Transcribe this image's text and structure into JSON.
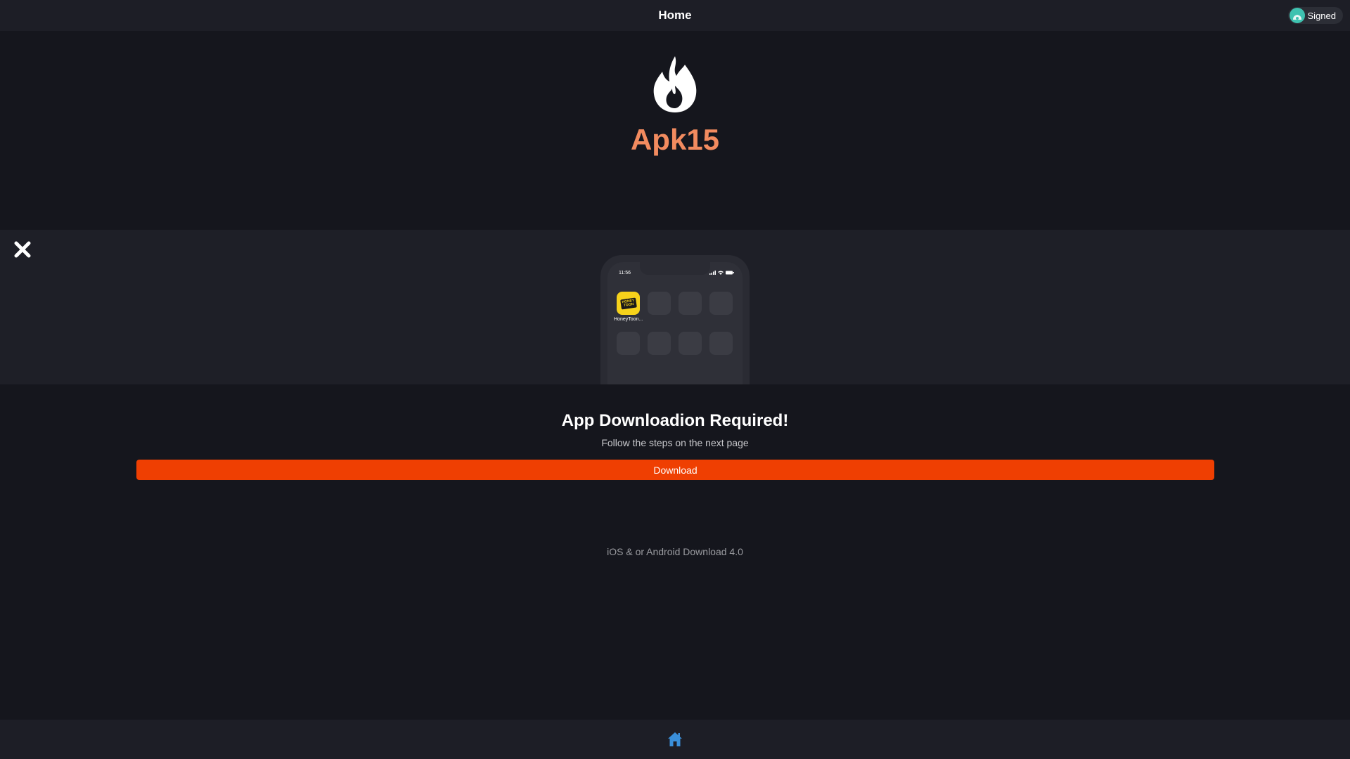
{
  "header": {
    "title": "Home",
    "signed_label": "Signed",
    "avatar_icon": "cloud-avatar-icon"
  },
  "hero": {
    "logo_icon": "flame-icon",
    "brand": "Apk15",
    "brand_color": "#f28b5f"
  },
  "preview": {
    "close_icon": "close-icon",
    "phone": {
      "status_time": "11:56",
      "app": {
        "label": "HoneyToon...",
        "logo_text_top": "HONEY",
        "logo_text_bottom": "TOON"
      },
      "empty_slots": 7
    }
  },
  "main": {
    "heading": "App Downloadion Required!",
    "subtitle": "Follow the steps on the next page",
    "download_label": "Download",
    "download_color": "#ef3f02",
    "version_text": "iOS & or Android Download 4.0"
  },
  "footer": {
    "home_icon": "home-icon",
    "home_color": "#3a8fd9"
  }
}
